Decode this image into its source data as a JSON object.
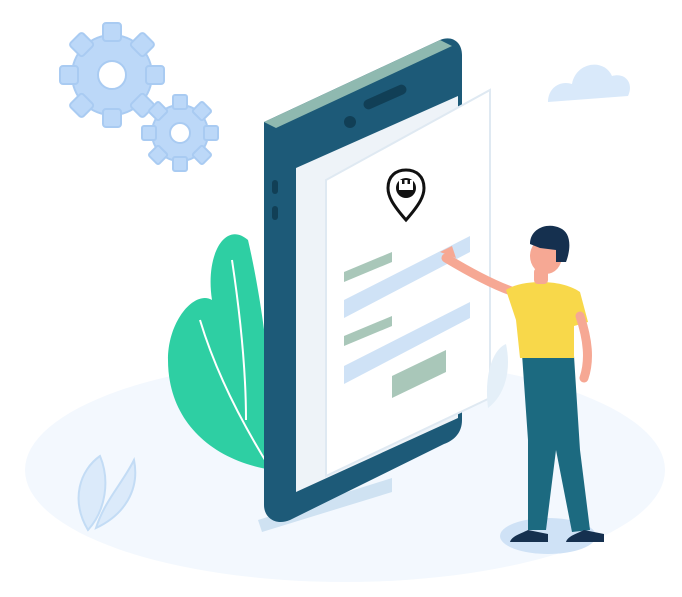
{
  "illustration": {
    "icons": [
      "gear-icon",
      "cloud-icon",
      "map-pin-icon",
      "leaf-icon"
    ],
    "colors": {
      "phone_body": "#1d5a78",
      "phone_top": "#8fb9b0",
      "screen": "#eef3f8",
      "card": "#ffffff",
      "form_field": "#cfe2f6",
      "form_label": "#a9c7b9",
      "accent_green": "#2ecfa3",
      "shirt": "#f8d84a",
      "pants": "#1c6a80",
      "hair": "#15304f",
      "skin": "#f6a894",
      "gear": "#bcd8f8",
      "ground": "#f3f8fe"
    }
  }
}
